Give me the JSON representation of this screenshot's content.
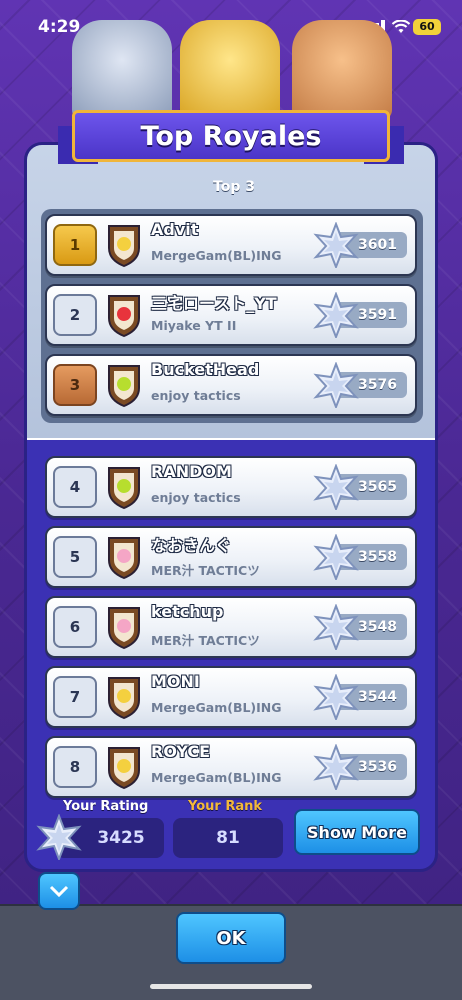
{
  "status": {
    "time": "4:29",
    "battery": "60"
  },
  "header": {
    "title": "Top Royales",
    "section_label": "Top 3"
  },
  "colors": {
    "gold": "#f0b53a",
    "accent_blue": "#1d8fe6",
    "panel": "#3b31b4"
  },
  "players": [
    {
      "rank": "1",
      "name": "Advit",
      "clan": "MergeGam(BL)ING",
      "trophies": "3601",
      "badge_icon": "skull-badge-icon"
    },
    {
      "rank": "2",
      "name": "三宅ロースト_YT",
      "clan": "Miyake YT II",
      "trophies": "3591",
      "badge_icon": "japan-flag-badge-icon"
    },
    {
      "rank": "3",
      "name": "BucketHead",
      "clan": "enjoy tactics",
      "trophies": "3576",
      "badge_icon": "tennis-ball-badge-icon"
    },
    {
      "rank": "4",
      "name": "RANDOM",
      "clan": "enjoy tactics",
      "trophies": "3565",
      "badge_icon": "tennis-ball-badge-icon"
    },
    {
      "rank": "5",
      "name": "なおきんぐ",
      "clan": "MER汁 TACTICツ",
      "trophies": "3558",
      "badge_icon": "blossom-badge-icon"
    },
    {
      "rank": "6",
      "name": "ketchup",
      "clan": "MER汁 TACTICツ",
      "trophies": "3548",
      "badge_icon": "blossom-badge-icon"
    },
    {
      "rank": "7",
      "name": "MONI",
      "clan": "MergeGam(BL)ING",
      "trophies": "3544",
      "badge_icon": "skull-badge-icon"
    },
    {
      "rank": "8",
      "name": "ROYCE",
      "clan": "MergeGam(BL)ING",
      "trophies": "3536",
      "badge_icon": "skull-badge-icon"
    }
  ],
  "footer": {
    "rating_label": "Your Rating",
    "rating_value": "3425",
    "rank_label": "Your Rank",
    "rank_value": "81",
    "show_more_label": "Show More"
  },
  "ok_label": "OK"
}
